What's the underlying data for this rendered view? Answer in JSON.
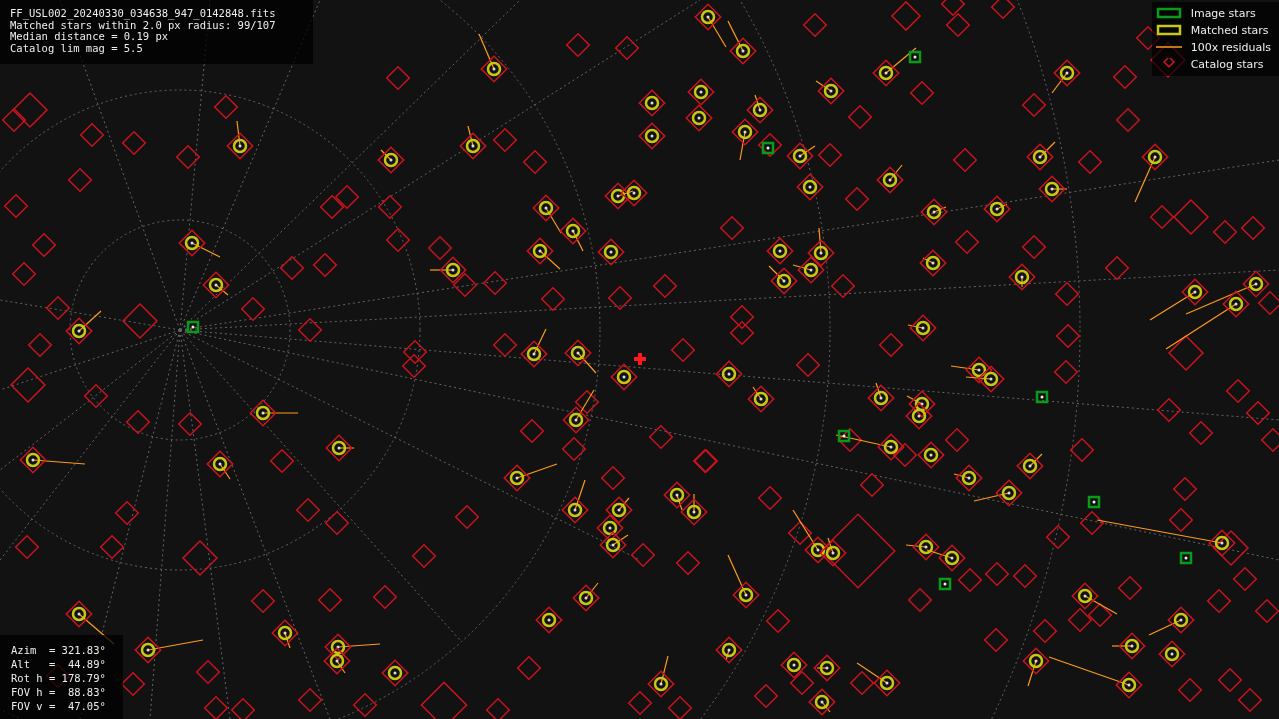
{
  "info_lines": [
    "FF_USL002_20240330_034638_947_0142848.fits",
    "Matched stars within 2.0 px radius: 99/107",
    "Median distance = 0.19 px",
    "Catalog lim mag = 5.5"
  ],
  "legend": [
    {
      "kind": "image",
      "label": "Image stars"
    },
    {
      "kind": "matched",
      "label": "Matched stars"
    },
    {
      "kind": "residual",
      "label": "100x residuals"
    },
    {
      "kind": "catalog",
      "label": "Catalog stars"
    }
  ],
  "pointing": [
    "Azim  = 321.83°",
    "Alt   =  44.89°",
    "Rot h = 178.79°",
    "FOV h =  88.83°",
    "FOV v =  47.05°"
  ]
}
